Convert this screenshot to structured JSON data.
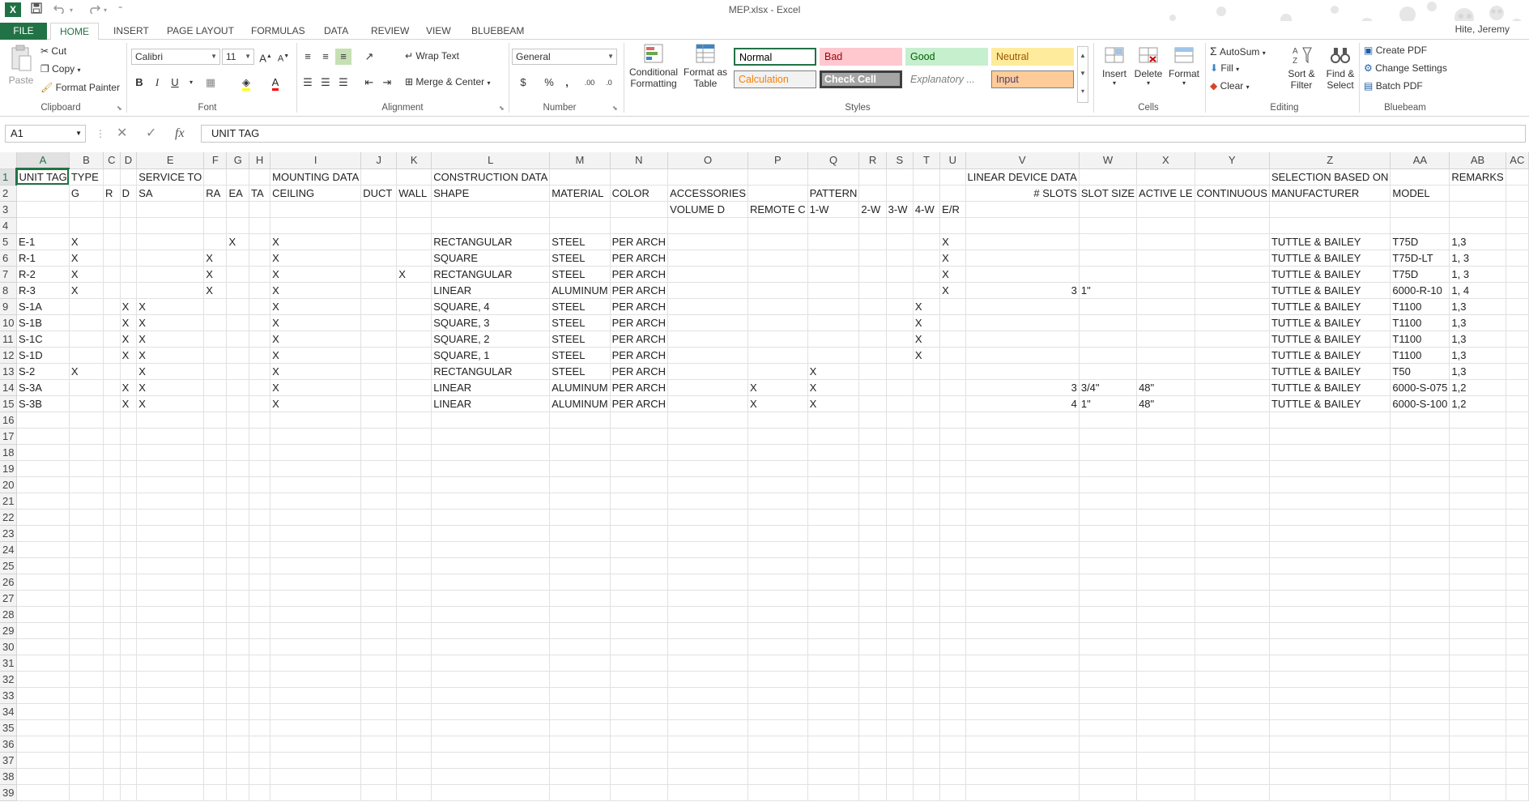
{
  "window": {
    "title": "MEP.xlsx - Excel",
    "user": "Hite, Jeremy",
    "app_icon": "X"
  },
  "icons": {
    "app": "excel-icon",
    "save": "save-icon",
    "undo": "undo-icon",
    "redo": "redo-icon",
    "customize": "customize-qat-icon"
  },
  "tabs": [
    "FILE",
    "HOME",
    "INSERT",
    "PAGE LAYOUT",
    "FORMULAS",
    "DATA",
    "REVIEW",
    "VIEW",
    "BLUEBEAM"
  ],
  "active_tab": "HOME",
  "ribbon": {
    "clipboard": {
      "label": "Clipboard",
      "paste": "Paste",
      "cut": "Cut",
      "copy": "Copy",
      "format_painter": "Format Painter"
    },
    "font": {
      "label": "Font",
      "name": "Calibri",
      "size": "11",
      "bold": "B",
      "italic": "I",
      "underline": "U"
    },
    "alignment": {
      "label": "Alignment",
      "wrap_text": "Wrap Text",
      "merge_center": "Merge & Center"
    },
    "number": {
      "label": "Number",
      "format": "General",
      "currency": "$",
      "percent": "%",
      "comma": ","
    },
    "styles": {
      "label": "Styles",
      "conditional_formatting": "Conditional Formatting",
      "format_as_table": "Format as Table",
      "cells": [
        {
          "name": "Normal",
          "bg": "#ffffff",
          "fg": "#000000",
          "border": "#217346"
        },
        {
          "name": "Bad",
          "bg": "#ffc7ce",
          "fg": "#9c0006",
          "border": "#ffc7ce"
        },
        {
          "name": "Good",
          "bg": "#c6efce",
          "fg": "#006100",
          "border": "#c6efce"
        },
        {
          "name": "Neutral",
          "bg": "#ffeb9c",
          "fg": "#9c5700",
          "border": "#ffeb9c"
        },
        {
          "name": "Calculation",
          "bg": "#f2f2f2",
          "fg": "#fa7d00",
          "border": "#7f7f7f"
        },
        {
          "name": "Check Cell",
          "bg": "#a5a5a5",
          "fg": "#ffffff",
          "border": "#3f3f3f"
        },
        {
          "name": "Explanatory ...",
          "bg": "#ffffff",
          "fg": "#7f7f7f",
          "border": "#ffffff"
        },
        {
          "name": "Input",
          "bg": "#ffcc99",
          "fg": "#3f3f76",
          "border": "#7f7f7f"
        }
      ]
    },
    "cells": {
      "label": "Cells",
      "insert": "Insert",
      "delete": "Delete",
      "format": "Format"
    },
    "editing": {
      "label": "Editing",
      "autosum": "AutoSum",
      "fill": "Fill",
      "clear": "Clear",
      "sort_filter": "Sort & Filter",
      "find_select": "Find & Select"
    },
    "bluebeam": {
      "label": "Bluebeam",
      "create_pdf": "Create PDF",
      "change_settings": "Change Settings",
      "batch_pdf": "Batch PDF"
    }
  },
  "formula_bar": {
    "name_box": "A1",
    "fx": "fx",
    "content": "UNIT TAG"
  },
  "sheet": {
    "columns": [
      "A",
      "B",
      "C",
      "D",
      "E",
      "F",
      "G",
      "H",
      "I",
      "J",
      "K",
      "L",
      "M",
      "N",
      "O",
      "P",
      "Q",
      "R",
      "S",
      "T",
      "U",
      "V",
      "W",
      "X",
      "Y",
      "Z",
      "AA",
      "AB",
      "AC"
    ],
    "row_count": 39,
    "numeric_columns": [
      "V"
    ],
    "active_cell": "A1",
    "cells": {
      "1": {
        "A": "UNIT TAG",
        "B": "TYPE",
        "E": "SERVICE TO",
        "I": "MOUNTING DATA",
        "L": "CONSTRUCTION DATA",
        "V": "LINEAR DEVICE DATA",
        "Z": "SELECTION BASED ON",
        "AB": "REMARKS"
      },
      "2": {
        "B": "G",
        "C": "R",
        "D": "D",
        "E": "SA",
        "F": "RA",
        "G": "EA",
        "H": "TA",
        "I": "CEILING",
        "J": "DUCT",
        "K": "WALL",
        "L": "SHAPE",
        "M": "MATERIAL",
        "N": "COLOR",
        "O": "ACCESSORIES",
        "Q": "PATTERN",
        "V": "# SLOTS",
        "W": "SLOT SIZE",
        "X": "ACTIVE LE",
        "Y": "CONTINUOUS",
        "Z": "MANUFACTURER",
        "AA": "MODEL"
      },
      "3": {
        "O": "VOLUME D",
        "P": "REMOTE C",
        "Q": "1-W",
        "R": "2-W",
        "S": "3-W",
        "T": "4-W",
        "U": "E/R"
      },
      "5": {
        "A": "E-1",
        "B": "X",
        "G": "X",
        "I": "X",
        "L": "RECTANGULAR",
        "M": "STEEL",
        "N": "PER ARCH",
        "U": "X",
        "Z": "TUTTLE & BAILEY",
        "AA": "T75D",
        "AB": "1,3"
      },
      "6": {
        "A": "R-1",
        "B": "X",
        "F": "X",
        "I": "X",
        "L": "SQUARE",
        "M": "STEEL",
        "N": "PER ARCH",
        "U": "X",
        "Z": "TUTTLE & BAILEY",
        "AA": "T75D-LT",
        "AB": "1, 3"
      },
      "7": {
        "A": "R-2",
        "B": "X",
        "F": "X",
        "I": "X",
        "K": "X",
        "L": "RECTANGULAR",
        "M": "STEEL",
        "N": "PER ARCH",
        "U": "X",
        "Z": "TUTTLE & BAILEY",
        "AA": "T75D",
        "AB": "1, 3"
      },
      "8": {
        "A": "R-3",
        "B": "X",
        "F": "X",
        "I": "X",
        "L": "LINEAR",
        "M": "ALUMINUM",
        "N": "PER ARCH",
        "U": "X",
        "V": "3",
        "W": "1\"",
        "Z": "TUTTLE & BAILEY",
        "AA": "6000-R-10",
        "AB": "1, 4"
      },
      "9": {
        "A": "S-1A",
        "D": "X",
        "E": "X",
        "I": "X",
        "L": "SQUARE, 4",
        "M": "STEEL",
        "N": "PER ARCH",
        "T": "X",
        "Z": "TUTTLE & BAILEY",
        "AA": "T1100",
        "AB": "1,3"
      },
      "10": {
        "A": "S-1B",
        "D": "X",
        "E": "X",
        "I": "X",
        "L": "SQUARE, 3",
        "M": "STEEL",
        "N": "PER ARCH",
        "T": "X",
        "Z": "TUTTLE & BAILEY",
        "AA": "T1100",
        "AB": "1,3"
      },
      "11": {
        "A": "S-1C",
        "D": "X",
        "E": "X",
        "I": "X",
        "L": "SQUARE, 2",
        "M": "STEEL",
        "N": "PER ARCH",
        "T": "X",
        "Z": "TUTTLE & BAILEY",
        "AA": "T1100",
        "AB": "1,3"
      },
      "12": {
        "A": "S-1D",
        "D": "X",
        "E": "X",
        "I": "X",
        "L": "SQUARE, 1",
        "M": "STEEL",
        "N": "PER ARCH",
        "T": "X",
        "Z": "TUTTLE & BAILEY",
        "AA": "T1100",
        "AB": "1,3"
      },
      "13": {
        "A": "S-2",
        "B": "X",
        "E": "X",
        "I": "X",
        "L": "RECTANGULAR",
        "M": "STEEL",
        "N": "PER ARCH",
        "Q": "X",
        "Z": "TUTTLE & BAILEY",
        "AA": "T50",
        "AB": "1,3"
      },
      "14": {
        "A": "S-3A",
        "D": "X",
        "E": "X",
        "I": "X",
        "L": "LINEAR",
        "M": "ALUMINUM",
        "N": "PER ARCH",
        "P": "X",
        "Q": "X",
        "V": "3",
        "W": "3/4\"",
        "X": "48\"",
        "Z": "TUTTLE & BAILEY",
        "AA": "6000-S-075",
        "AB": "1,2"
      },
      "15": {
        "A": "S-3B",
        "D": "X",
        "E": "X",
        "I": "X",
        "L": "LINEAR",
        "M": "ALUMINUM",
        "N": "PER ARCH",
        "P": "X",
        "Q": "X",
        "V": "4",
        "W": "1\"",
        "X": "48\"",
        "Z": "TUTTLE & BAILEY",
        "AA": "6000-S-100",
        "AB": "1,2"
      }
    }
  }
}
